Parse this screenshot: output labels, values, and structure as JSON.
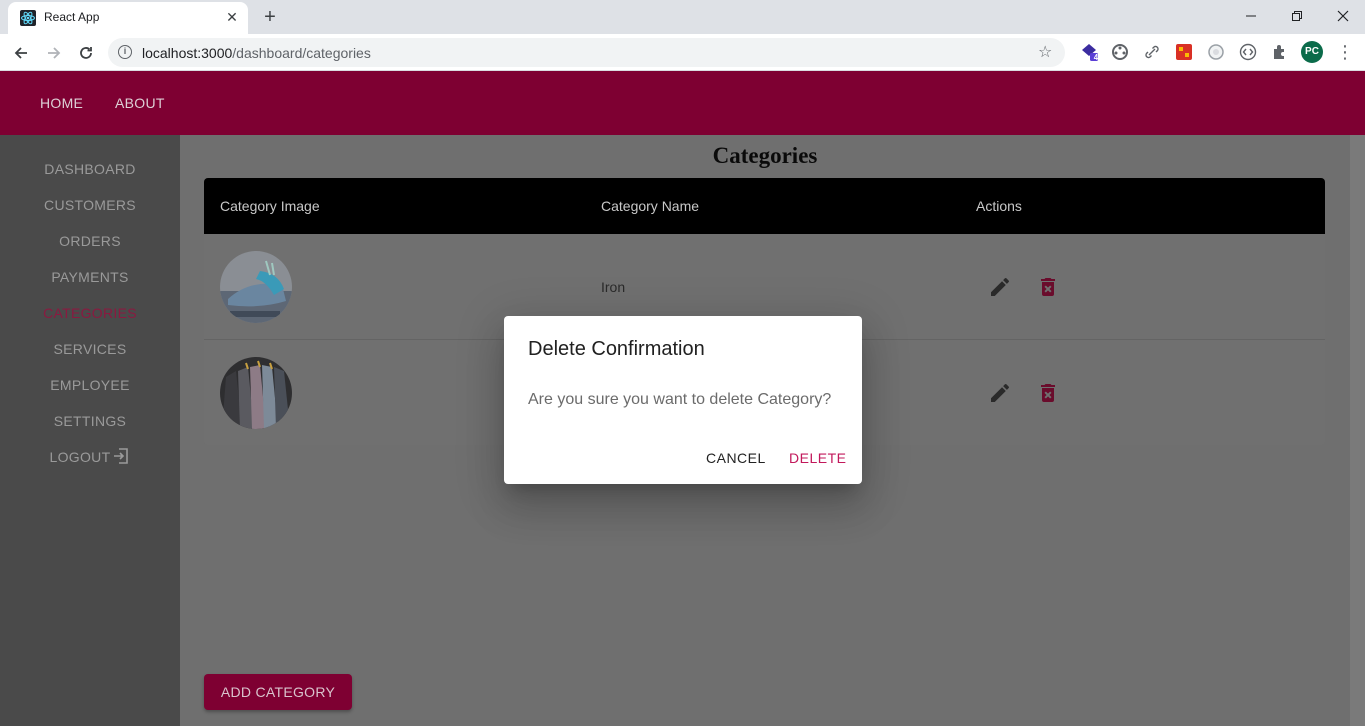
{
  "browser": {
    "tab_title": "React App",
    "tab_close": "✕",
    "new_tab": "+",
    "url_host": "localhost:3000",
    "url_path": "/dashboard/categories",
    "extension_badge": "4",
    "profile_initials": "PC"
  },
  "appbar": {
    "links": [
      "HOME",
      "ABOUT"
    ]
  },
  "sidebar": {
    "items": [
      "DASHBOARD",
      "CUSTOMERS",
      "ORDERS",
      "PAYMENTS",
      "CATEGORIES",
      "SERVICES",
      "EMPLOYEE",
      "SETTINGS",
      "LOGOUT"
    ],
    "active": "CATEGORIES"
  },
  "page": {
    "title": "Categories",
    "add_button": "ADD CATEGORY"
  },
  "table": {
    "headers": [
      "Category Image",
      "Category Name",
      "Actions"
    ],
    "rows": [
      {
        "name": "Iron",
        "image": "iron-photo"
      },
      {
        "name": "",
        "image": "shirts-photo"
      }
    ]
  },
  "dialog": {
    "title": "Delete Confirmation",
    "message": "Are you sure you want to delete Category?",
    "cancel": "CANCEL",
    "confirm": "DELETE"
  },
  "colors": {
    "brand": "#7e0032",
    "accent": "#c2185b",
    "overlay": "#6f6f6f"
  }
}
